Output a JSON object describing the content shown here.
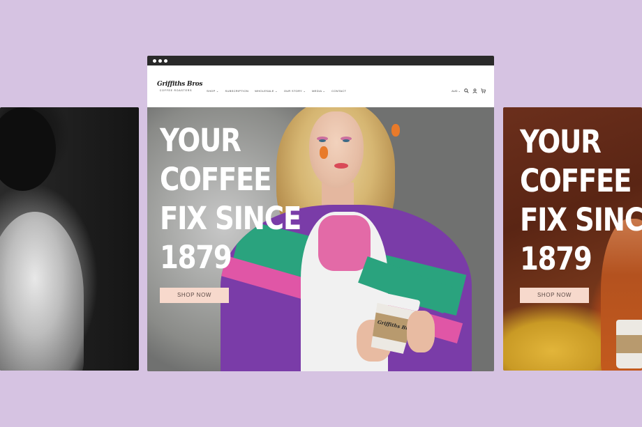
{
  "browser": {
    "dots": 3
  },
  "site": {
    "logo": {
      "name": "Griffiths Bros",
      "tagline": "COFFEE ROASTERS"
    },
    "nav": [
      {
        "label": "SHOP ⌄"
      },
      {
        "label": "SUBSCRIPTION"
      },
      {
        "label": "WHOLESALE ⌄"
      },
      {
        "label": "OUR STORY ⌄"
      },
      {
        "label": "MEDIA ⌄"
      },
      {
        "label": "CONTACT"
      }
    ],
    "currency": "AUD ⌄",
    "icons": [
      "search-icon",
      "account-icon",
      "cart-icon"
    ]
  },
  "hero": {
    "lines": [
      "YOUR",
      "COFFEE",
      "FIX SINCE",
      "1879"
    ],
    "button": "SHOP NOW",
    "cup_brand": "Griffiths Bros"
  },
  "right_panel": {
    "lines": [
      "YOUR",
      "COFFEE",
      "FIX SINCE",
      "1879"
    ],
    "button": "SHOP NOW"
  },
  "colors": {
    "background": "#d6c3e2",
    "browser_bar": "#2a2a2a",
    "button": "#f7d9cc"
  }
}
